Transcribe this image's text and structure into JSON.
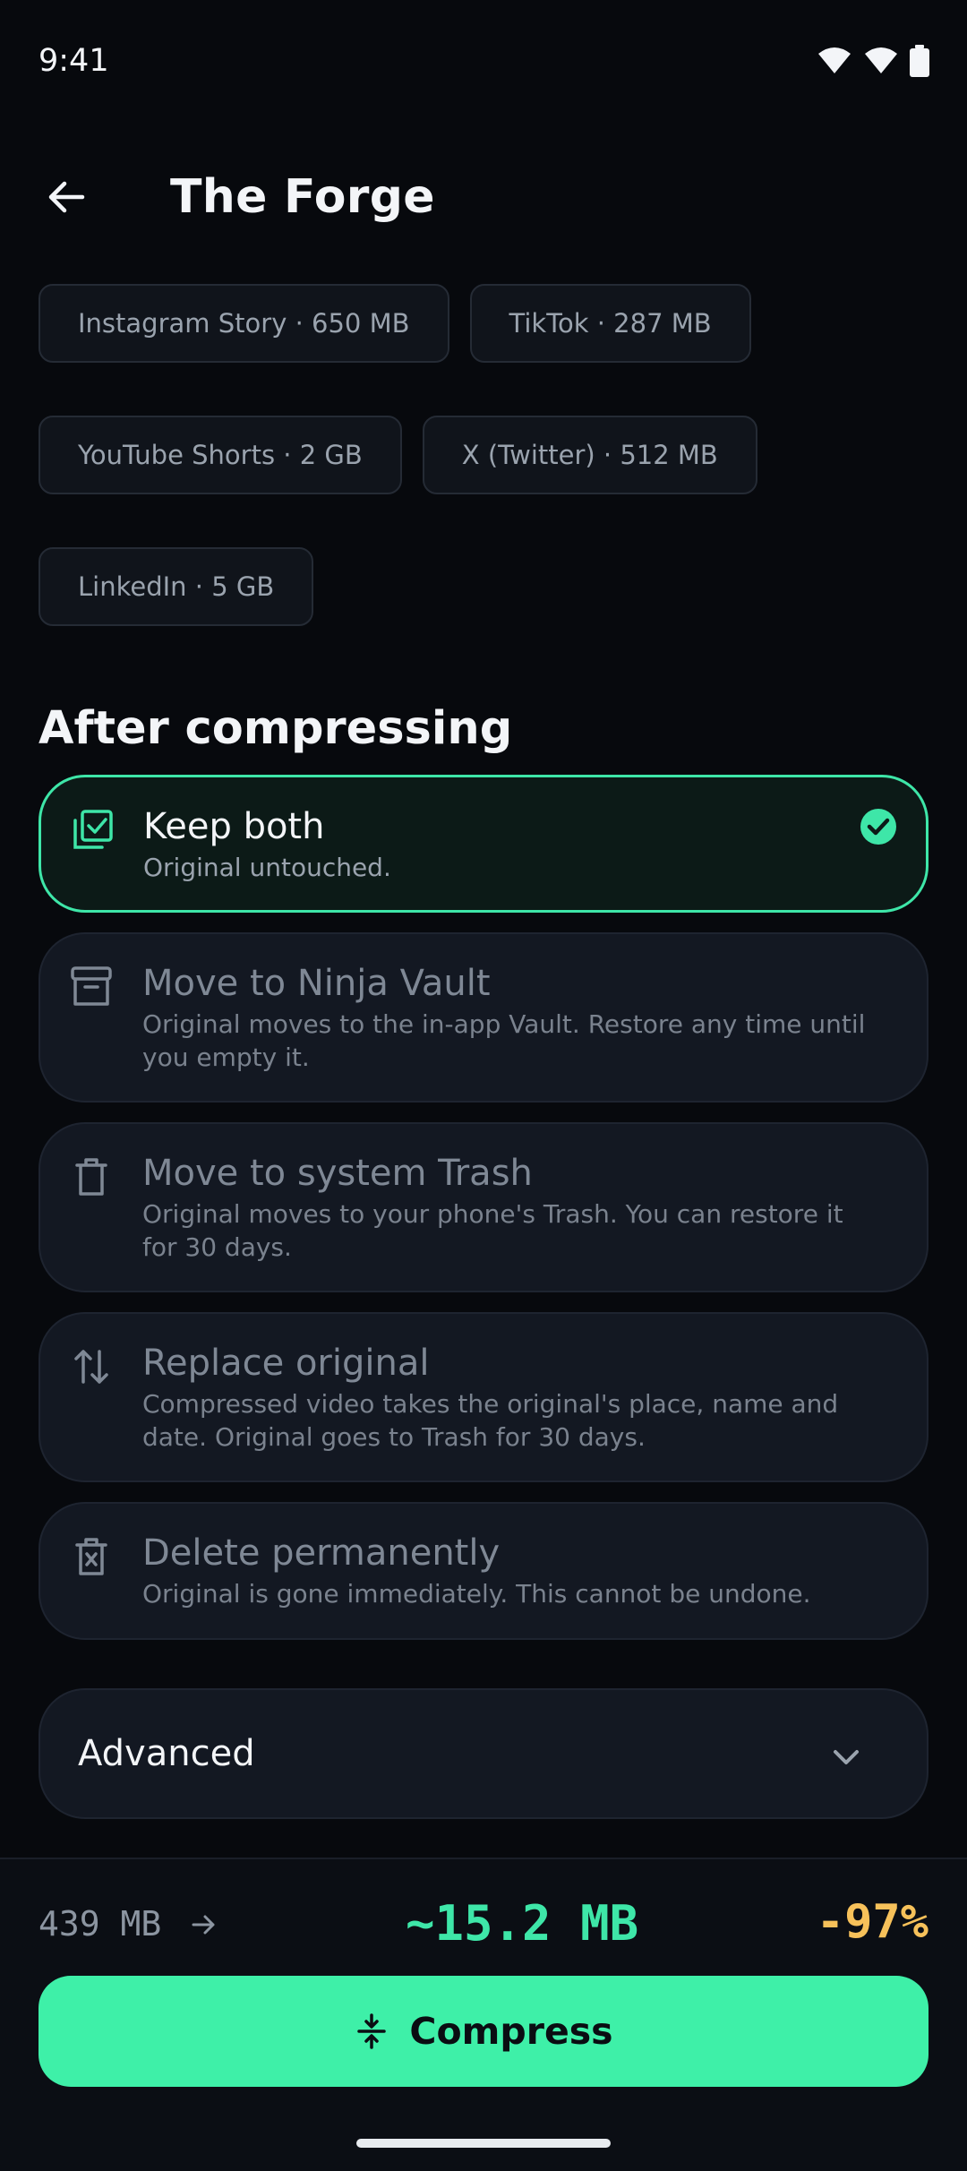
{
  "status_bar": {
    "time": "9:41"
  },
  "app_bar": {
    "title": "The Forge",
    "back_icon": "arrow-left-icon"
  },
  "presets": [
    [
      "Instagram Story · 650 MB",
      "TikTok · 287 MB"
    ],
    [
      "YouTube Shorts · 2 GB",
      "X (Twitter) · 512 MB"
    ],
    [
      "LinkedIn · 5 GB"
    ]
  ],
  "after_compressing": {
    "title": "After compressing",
    "selected_index": 0,
    "options": [
      {
        "icon": "checkbox-stack-icon",
        "title": "Keep both",
        "desc": "Original untouched."
      },
      {
        "icon": "archive-box-icon",
        "title": "Move to Ninja Vault",
        "desc": "Original moves to the in-app Vault. Restore any time until you empty it."
      },
      {
        "icon": "trash-icon",
        "title": "Move to system Trash",
        "desc": "Original moves to your phone's Trash. You can restore it for 30 days."
      },
      {
        "icon": "swap-vertical-icon",
        "title": "Replace original",
        "desc": "Compressed video takes the original's place, name and date. Original goes to Trash for 30 days."
      },
      {
        "icon": "delete-forever-icon",
        "title": "Delete permanently",
        "desc": "Original is gone immediately. This cannot be undone."
      }
    ]
  },
  "advanced": {
    "label": "Advanced"
  },
  "summary": {
    "from": "439 MB",
    "to": "~15.2 MB",
    "reduction": "-97%"
  },
  "compress_button": {
    "label": "Compress"
  },
  "colors": {
    "accent": "#3ee6a8",
    "warning": "#f7c15a",
    "background": "#07090d",
    "card": "#131822"
  }
}
